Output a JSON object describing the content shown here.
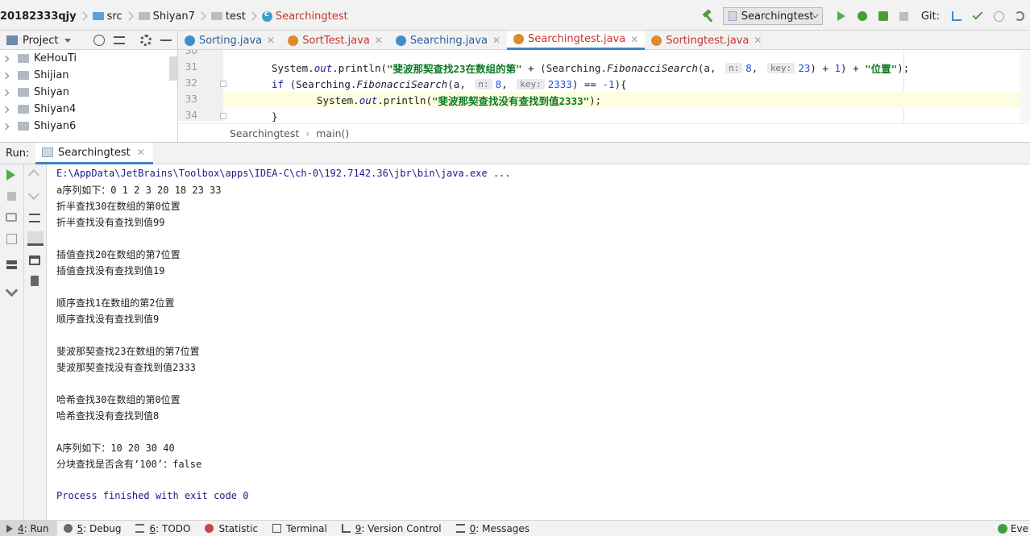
{
  "navbar": {
    "crumbs": [
      {
        "label": "20182333qjy",
        "kind": "project"
      },
      {
        "label": "src",
        "kind": "folder-blue"
      },
      {
        "label": "Shiyan7",
        "kind": "folder"
      },
      {
        "label": "test",
        "kind": "folder"
      },
      {
        "label": "Searchingtest",
        "kind": "class"
      }
    ],
    "run_config": "Searchingtest",
    "git_label": "Git:"
  },
  "project_panel": {
    "title": "Project",
    "tree": [
      "KeHouTi",
      "Shijian",
      "Shiyan",
      "Shiyan4",
      "Shiyan6"
    ]
  },
  "editor": {
    "tabs": [
      {
        "label": "Sorting.java",
        "icon_color": "#3d8fd0",
        "active": false
      },
      {
        "label": "SortTest.java",
        "icon_color": "#e08a2f",
        "active": false
      },
      {
        "label": "Searching.java",
        "icon_color": "#3d8fd0",
        "active": false
      },
      {
        "label": "Searchingtest.java",
        "icon_color": "#e08a2f",
        "active": true
      },
      {
        "label": "Sortingtest.java",
        "icon_color": "#e08a2f",
        "active": false
      }
    ],
    "line_numbers": [
      "30",
      "31",
      "32",
      "33",
      "34"
    ],
    "code": {
      "l31_a": "System.",
      "l31_out": "out",
      "l31_b": ".println(",
      "l31_str": "\"斐波那契查找23在数组的第\"",
      "l31_c": " + (Searching.",
      "l31_fn": "FibonacciSearch",
      "l31_d": "(a, ",
      "l31_hint1": "n:",
      "l31_n": "8",
      "l31_e": ", ",
      "l31_hint2": "key:",
      "l31_k": "23",
      "l31_f": ") + ",
      "l31_one": "1",
      "l31_g": ") + ",
      "l31_str2": "\"位置\"",
      "l31_h": ");",
      "l32_if": "if",
      "l32_a": " (Searching.",
      "l32_fn": "FibonacciSearch",
      "l32_b": "(a, ",
      "l32_hint1": "n:",
      "l32_n": "8",
      "l32_c": ", ",
      "l32_hint2": "key:",
      "l32_k": "2333",
      "l32_d": ") == ",
      "l32_m1": "-1",
      "l32_e": "){",
      "l33_a": "System.",
      "l33_out": "out",
      "l33_b": ".println(",
      "l33_str": "\"斐波那契查找没有查找到值2333\"",
      "l33_c": ");",
      "l34": "}"
    },
    "breadcrumb": [
      "Searchingtest",
      "main()"
    ]
  },
  "run_panel": {
    "label": "Run:",
    "tab": "Searchingtest",
    "console": [
      "E:\\AppData\\JetBrains\\Toolbox\\apps\\IDEA-C\\ch-0\\192.7142.36\\jbr\\bin\\java.exe ...",
      "a序列如下：0 1 2 3 20 18 23 33",
      "折半查找30在数组的第0位置",
      "折半查找没有查找到值99",
      "",
      "插值查找20在数组的第7位置",
      "插值查找没有查找到值19",
      "",
      "顺序查找1在数组的第2位置",
      "顺序查找没有查找到值9",
      "",
      "斐波那契查找23在数组的第7位置",
      "斐波那契查找没有查找到值2333",
      "",
      "哈希查找30在数组的第0位置",
      "哈希查找没有查找到值8",
      "",
      "A序列如下：10 20 30 40",
      "分块查找是否含有‘100’：false",
      "",
      "Process finished with exit code 0"
    ]
  },
  "bottom_bar": {
    "buttons": [
      {
        "key": "4",
        "label": ": Run",
        "icon": "play",
        "active": true
      },
      {
        "key": "5",
        "label": ": Debug",
        "icon": "bug",
        "active": false
      },
      {
        "key": "6",
        "label": ": TODO",
        "icon": "list",
        "active": false
      },
      {
        "key": "",
        "label": "Statistic",
        "icon": "stat",
        "active": false
      },
      {
        "key": "",
        "label": "Terminal",
        "icon": "term",
        "active": false
      },
      {
        "key": "9",
        "label": ": Version Control",
        "icon": "vcs",
        "active": false
      },
      {
        "key": "0",
        "label": ": Messages",
        "icon": "msg",
        "active": false
      }
    ],
    "event_log": "Eve"
  }
}
